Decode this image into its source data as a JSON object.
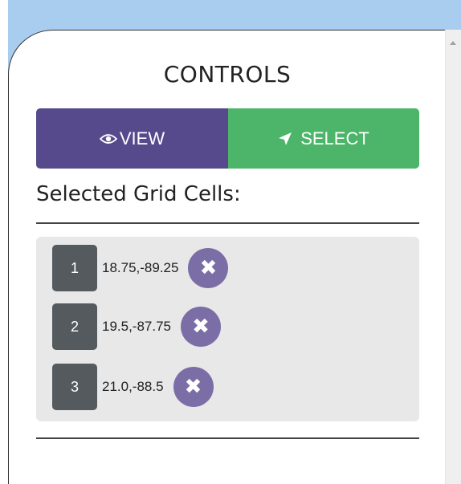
{
  "panel": {
    "title": "CONTROLS",
    "mode_buttons": {
      "view_label": "VIEW",
      "select_label": "SELECT",
      "view_color": "#564a8c",
      "select_color": "#4cb56a"
    },
    "selected_label": "Selected Grid Cells:",
    "cells": [
      {
        "index": "1",
        "coords": "18.75,-89.25"
      },
      {
        "index": "2",
        "coords": "19.5,-87.75"
      },
      {
        "index": "3",
        "coords": "21.0,-88.5"
      }
    ],
    "remove_glyph": "✖"
  },
  "icons": {
    "view": "eye-icon",
    "select": "location-arrow-icon",
    "remove": "remove-icon"
  },
  "select_icon_glyph": "➤"
}
